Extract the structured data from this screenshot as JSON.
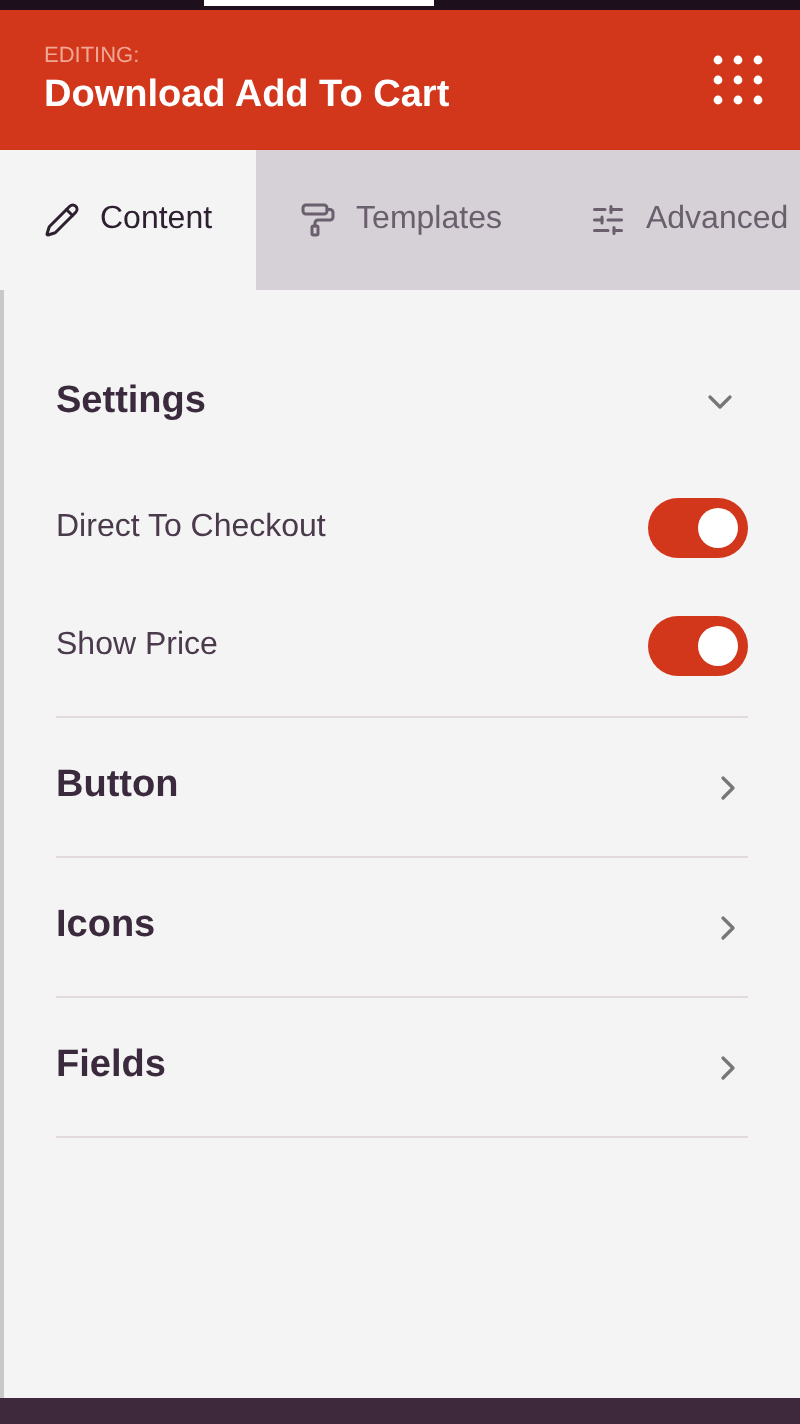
{
  "header": {
    "label": "EDITING:",
    "title": "Download Add To Cart"
  },
  "tabs": [
    {
      "label": "Content",
      "selected": true
    },
    {
      "label": "Templates",
      "selected": false
    },
    {
      "label": "Advanced",
      "selected": false
    }
  ],
  "settings": {
    "title": "Settings",
    "expanded": true,
    "toggles": [
      {
        "label": "Direct To Checkout",
        "on": true
      },
      {
        "label": "Show Price",
        "on": true
      }
    ]
  },
  "sections": [
    {
      "title": "Button",
      "expanded": false
    },
    {
      "title": "Icons",
      "expanded": false
    },
    {
      "title": "Fields",
      "expanded": false
    }
  ]
}
